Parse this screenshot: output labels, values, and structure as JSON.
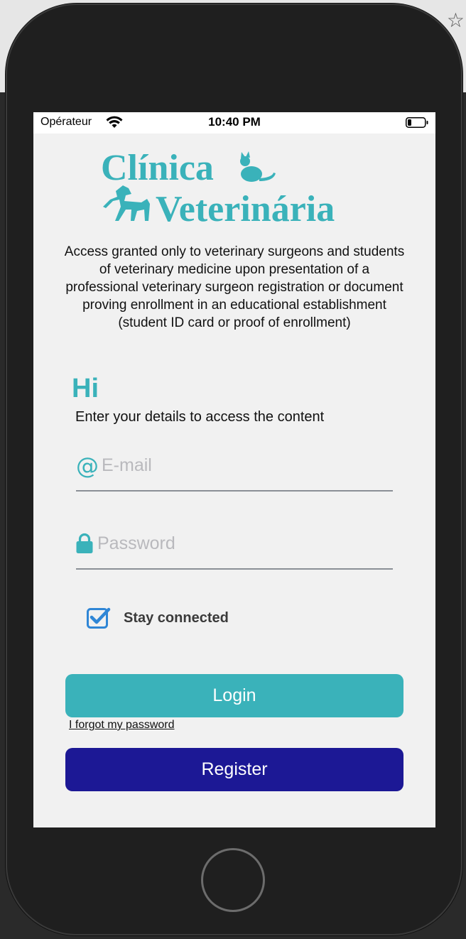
{
  "status_bar": {
    "carrier": "Opérateur",
    "time": "10:40 PM"
  },
  "logo": {
    "line1": "Clínica",
    "line2": "Veterinária"
  },
  "notice": "Access granted only to veterinary surgeons and students of veterinary medicine upon presentation of a professional veterinary surgeon registration or document proving enrollment in an educational establishment (student ID card or proof of enrollment)",
  "greeting": "Hi",
  "subtitle": "Enter your details to access the content",
  "email": {
    "icon": "@",
    "placeholder": "E-mail",
    "value": ""
  },
  "password": {
    "placeholder": "Password",
    "value": ""
  },
  "stay_connected": {
    "label": "Stay connected",
    "checked": true
  },
  "buttons": {
    "login": "Login",
    "forgot_password": "I forgot my password",
    "register": "Register"
  },
  "icons": {
    "wifi": "wifi-icon",
    "battery": "battery-icon",
    "email": "at-icon",
    "password": "lock-icon",
    "checkbox": "checkbox-checked-icon",
    "toolbar": "star-icon",
    "home": "home-button-icon"
  },
  "colors": {
    "accent_teal": "#3ab2ba",
    "register_navy": "#1c1895",
    "checkbox_blue": "#2f86d6"
  }
}
